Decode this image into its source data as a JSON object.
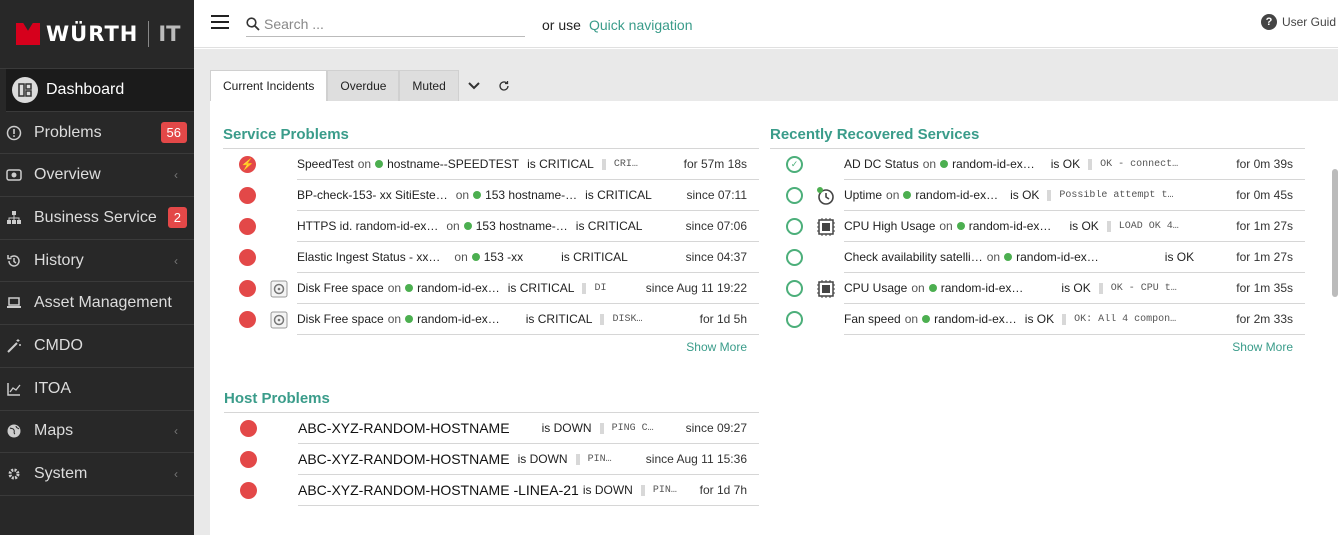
{
  "brand": {
    "name": "WÜRTH",
    "suffix": "IT"
  },
  "sidebar": {
    "items": [
      {
        "label": "Dashboard"
      },
      {
        "label": "Problems",
        "badge": "56"
      },
      {
        "label": "Overview"
      },
      {
        "label": "Business Service",
        "badge": "2"
      },
      {
        "label": "History"
      },
      {
        "label": "Asset Management"
      },
      {
        "label": "CMDO"
      },
      {
        "label": "ITOA"
      },
      {
        "label": "Maps"
      },
      {
        "label": "System"
      }
    ]
  },
  "topbar": {
    "search_placeholder": "Search ...",
    "or_use": "or use",
    "quick_nav": "Quick navigation",
    "user_guide": "User Guid"
  },
  "tabs": {
    "current": "Current Incidents",
    "overdue": "Overdue",
    "muted": "Muted"
  },
  "service_problems": {
    "title": "Service Problems",
    "show_more": "Show More",
    "rows": [
      {
        "service": "SpeedTest",
        "on": "on",
        "host": "hostname--SPEEDTEST",
        "state": "is CRITICAL",
        "output": "CRI…",
        "since": "for 57m 18s"
      },
      {
        "service": "BP-check-153- xx SitiEste…",
        "on": "on",
        "host": "153 hostname-…",
        "state": "is CRITICAL",
        "output": "",
        "since": "since 07:11"
      },
      {
        "service": "HTTPS id. random-id-ex…",
        "on": "on",
        "host": "153 hostname-…",
        "state": "is CRITICAL",
        "output": "",
        "since": "since 07:06"
      },
      {
        "service": "Elastic Ingest Status -  xx…",
        "on": "on",
        "host": "153 -xx",
        "state": "is CRITICAL",
        "output": "",
        "since": "since 04:37"
      },
      {
        "service": "Disk Free space",
        "on": "on",
        "host": "random-id-ex…",
        "state": "is CRITICAL",
        "output": "DI",
        "since": "since Aug 11 19:22"
      },
      {
        "service": "Disk Free space",
        "on": "on",
        "host": "random-id-ex…",
        "state": "is CRITICAL",
        "output": "DISK…",
        "since": "for 1d 5h"
      }
    ]
  },
  "recovered": {
    "title": "Recently Recovered Services",
    "show_more": "Show More",
    "rows": [
      {
        "service": "AD DC Status",
        "on": "on",
        "host": "random-id-ex…",
        "state": "is OK",
        "output": "OK - connect…",
        "since": "for 0m 39s"
      },
      {
        "service": "Uptime",
        "on": "on",
        "host": "random-id-ex…",
        "state": "is OK",
        "output": "Possible attempt t…",
        "since": "for 0m 45s"
      },
      {
        "service": "CPU High Usage",
        "on": "on",
        "host": "random-id-ex…",
        "state": "is OK",
        "output": "LOAD OK 4…",
        "since": "for 1m 27s"
      },
      {
        "service": "Check availability satelli…",
        "on": "on",
        "host": "random-id-ex…",
        "state": "is OK",
        "output": "",
        "since": "for 1m 27s"
      },
      {
        "service": "CPU Usage",
        "on": "on",
        "host": "random-id-ex…",
        "state": "is OK",
        "output": "OK - CPU t…",
        "since": "for 1m 35s"
      },
      {
        "service": "Fan speed",
        "on": "on",
        "host": "random-id-ex…",
        "state": "is OK",
        "output": "OK: All 4 compon…",
        "since": "for 2m 33s"
      }
    ]
  },
  "host_problems": {
    "title": "Host Problems",
    "rows": [
      {
        "host": "ABC-XYZ-RANDOM-HOSTNAME",
        "state": "is DOWN",
        "output": "PING C…",
        "since": "since 09:27"
      },
      {
        "host": "ABC-XYZ-RANDOM-HOSTNAME",
        "state": "is DOWN",
        "output": "PIN…",
        "since": "since Aug 11 15:36"
      },
      {
        "host": "ABC-XYZ-RANDOM-HOSTNAME -LINEA-21",
        "state": "is DOWN",
        "output": "PIN…",
        "since": "for 1d 7h"
      }
    ]
  },
  "colors": {
    "accent": "#3a9c8a",
    "critical": "#e34848",
    "ok": "#4caf7a",
    "sidebar": "#282828"
  }
}
